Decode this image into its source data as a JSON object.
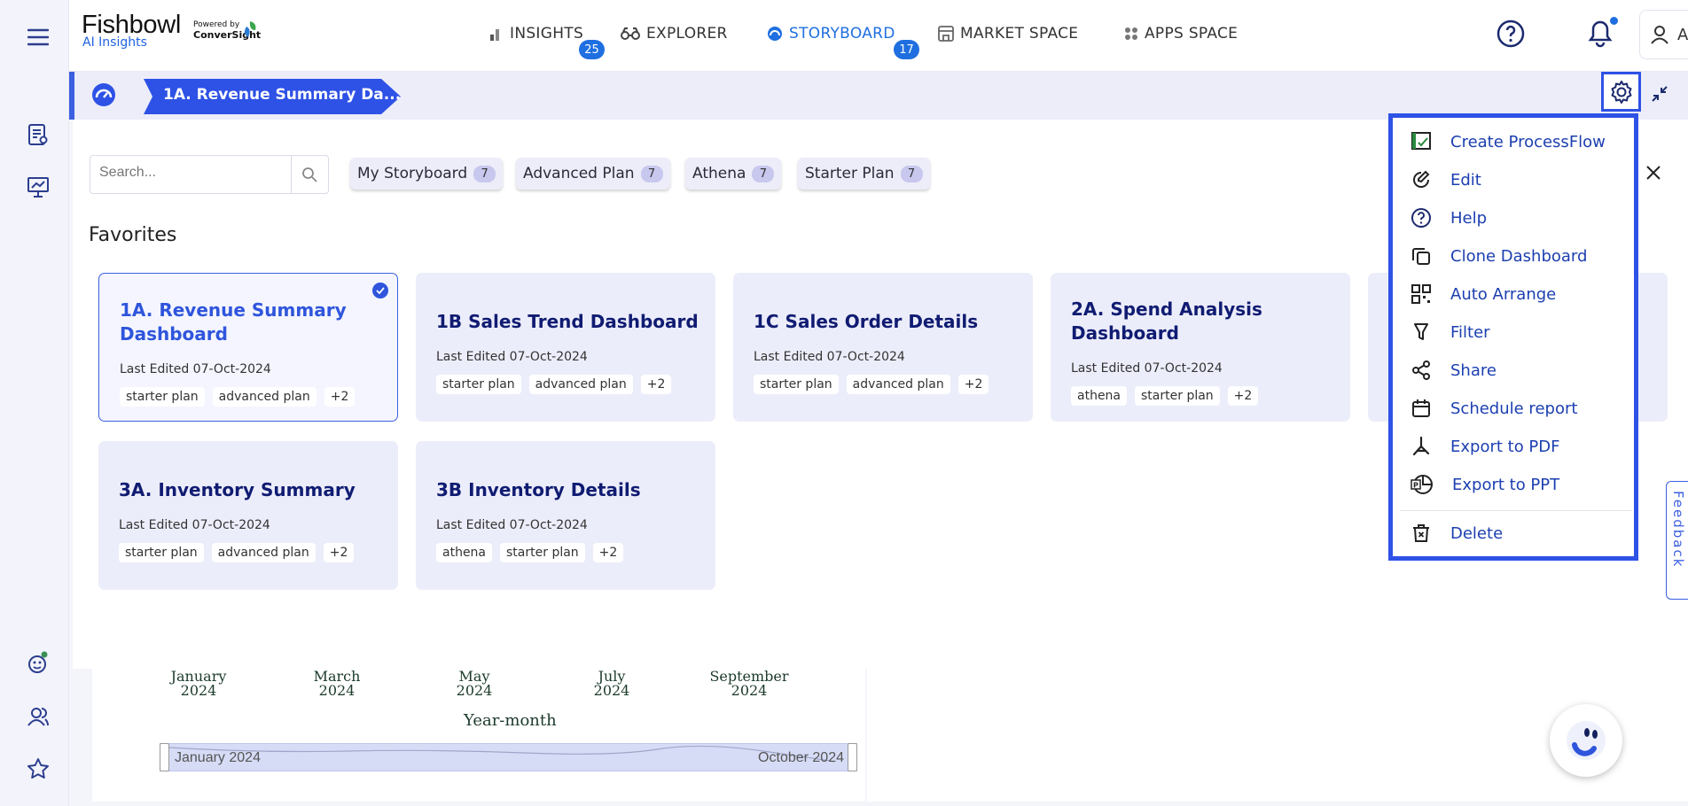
{
  "brand": {
    "name": "Fishbowl",
    "product": "AI Insights",
    "powered_by": "Powered by",
    "powered_brand": "ConverSight"
  },
  "nav": [
    {
      "label": "INSIGHTS",
      "badge": "25"
    },
    {
      "label": "EXPLORER",
      "badge": ""
    },
    {
      "label": "STORYBOARD",
      "badge": "17"
    },
    {
      "label": "MARKET SPACE",
      "badge": ""
    },
    {
      "label": "APPS SPACE",
      "badge": ""
    }
  ],
  "user": {
    "name": "Admin"
  },
  "breadcrumb": {
    "current": "1A. Revenue Summary Da..."
  },
  "search": {
    "placeholder": "Search..."
  },
  "filters": [
    {
      "label": "My Storyboard",
      "count": "7"
    },
    {
      "label": "Advanced Plan",
      "count": "7"
    },
    {
      "label": "Athena",
      "count": "7"
    },
    {
      "label": "Starter Plan",
      "count": "7"
    }
  ],
  "favorites_title": "Favorites",
  "cards": [
    {
      "title": "1A. Revenue Summary Dashboard",
      "edited": "Last Edited 07-Oct-2024",
      "tags": [
        "starter plan",
        "advanced plan",
        "+2"
      ],
      "selected": true
    },
    {
      "title": "1B Sales Trend Dashboard",
      "edited": "Last Edited 07-Oct-2024",
      "tags": [
        "starter plan",
        "advanced plan",
        "+2"
      ]
    },
    {
      "title": "1C Sales Order Details",
      "edited": "Last Edited 07-Oct-2024",
      "tags": [
        "starter plan",
        "advanced plan",
        "+2"
      ]
    },
    {
      "title": "2A. Spend Analysis Dashboard",
      "edited": "Last Edited 07-Oct-2024",
      "tags": [
        "athena",
        "starter plan",
        "+2"
      ]
    },
    {
      "title": "3A. Inventory Summary",
      "edited": "Last Edited 07-Oct-2024",
      "tags": [
        "starter plan",
        "advanced plan",
        "+2"
      ]
    },
    {
      "title": "3B Inventory Details",
      "edited": "Last Edited 07-Oct-2024",
      "tags": [
        "athena",
        "starter plan",
        "+2"
      ]
    }
  ],
  "menu": [
    {
      "label": "Create ProcessFlow",
      "icon": "processflow-icon"
    },
    {
      "label": "Edit",
      "icon": "edit-icon"
    },
    {
      "label": "Help",
      "icon": "help-icon"
    },
    {
      "label": "Clone Dashboard",
      "icon": "clone-icon"
    },
    {
      "label": "Auto Arrange",
      "icon": "grid-icon"
    },
    {
      "label": "Filter",
      "icon": "filter-icon"
    },
    {
      "label": "Share",
      "icon": "share-icon"
    },
    {
      "label": "Schedule report",
      "icon": "calendar-icon"
    },
    {
      "label": "Export to PDF",
      "icon": "pdf-icon"
    },
    {
      "label": "Export to PPT",
      "icon": "ppt-icon"
    },
    {
      "label": "Delete",
      "icon": "trash-icon"
    }
  ],
  "chart": {
    "months": [
      {
        "m": "January",
        "y": "2024"
      },
      {
        "m": "March",
        "y": "2024"
      },
      {
        "m": "May",
        "y": "2024"
      },
      {
        "m": "July",
        "y": "2024"
      },
      {
        "m": "September",
        "y": "2024"
      }
    ],
    "xlabel": "Year-month",
    "range_start": "January 2024",
    "range_end": "October 2024"
  },
  "feedback": "Feedback",
  "colors": {
    "accent": "#1f6fe0",
    "menu_border": "#2e52e6",
    "card_bg": "#ecedfa",
    "title": "#101c72"
  }
}
